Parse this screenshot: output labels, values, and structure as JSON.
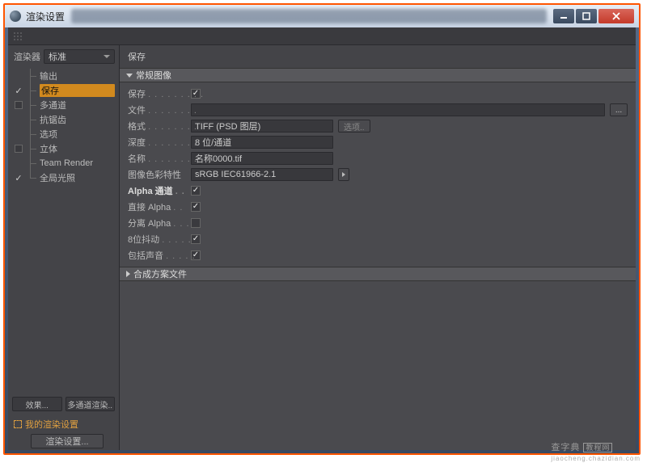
{
  "window": {
    "title": "渲染设置"
  },
  "sidebar": {
    "renderer_label": "渲染器",
    "renderer_value": "标准",
    "items": [
      {
        "label": "输出",
        "checked": null
      },
      {
        "label": "保存",
        "checked": true,
        "selected": true
      },
      {
        "label": "多通道",
        "checked": false
      },
      {
        "label": "抗锯齿",
        "checked": null
      },
      {
        "label": "选项",
        "checked": null
      },
      {
        "label": "立体",
        "checked": false
      },
      {
        "label": "Team Render",
        "checked": null
      },
      {
        "label": "全局光照",
        "checked": true
      }
    ],
    "effect_btn": "效果...",
    "multi_btn": "多通道渲染..",
    "preset": "我的渲染设置",
    "bottom_btn": "渲染设置..."
  },
  "panel": {
    "title": "保存",
    "section1": "常规图像",
    "section2": "合成方案文件",
    "fields": {
      "save": "保存",
      "file": "文件",
      "format": "格式",
      "format_value": "TIFF (PSD 图层)",
      "options": "选项..",
      "depth": "深度",
      "depth_value": "8 位/通道",
      "name": "名称",
      "name_value": "名称0000.tif",
      "color_profile": "图像色彩特性",
      "color_profile_value": "sRGB IEC61966-2.1",
      "alpha_channel": "Alpha 通道",
      "straight_alpha": "直接 Alpha",
      "separate_alpha": "分离 Alpha",
      "dither8": "8位抖动",
      "include_sound": "包括声音"
    }
  },
  "watermark": {
    "main": "查字典",
    "sub": "jiaocheng.chazidian.com",
    "tag": "教程网"
  }
}
